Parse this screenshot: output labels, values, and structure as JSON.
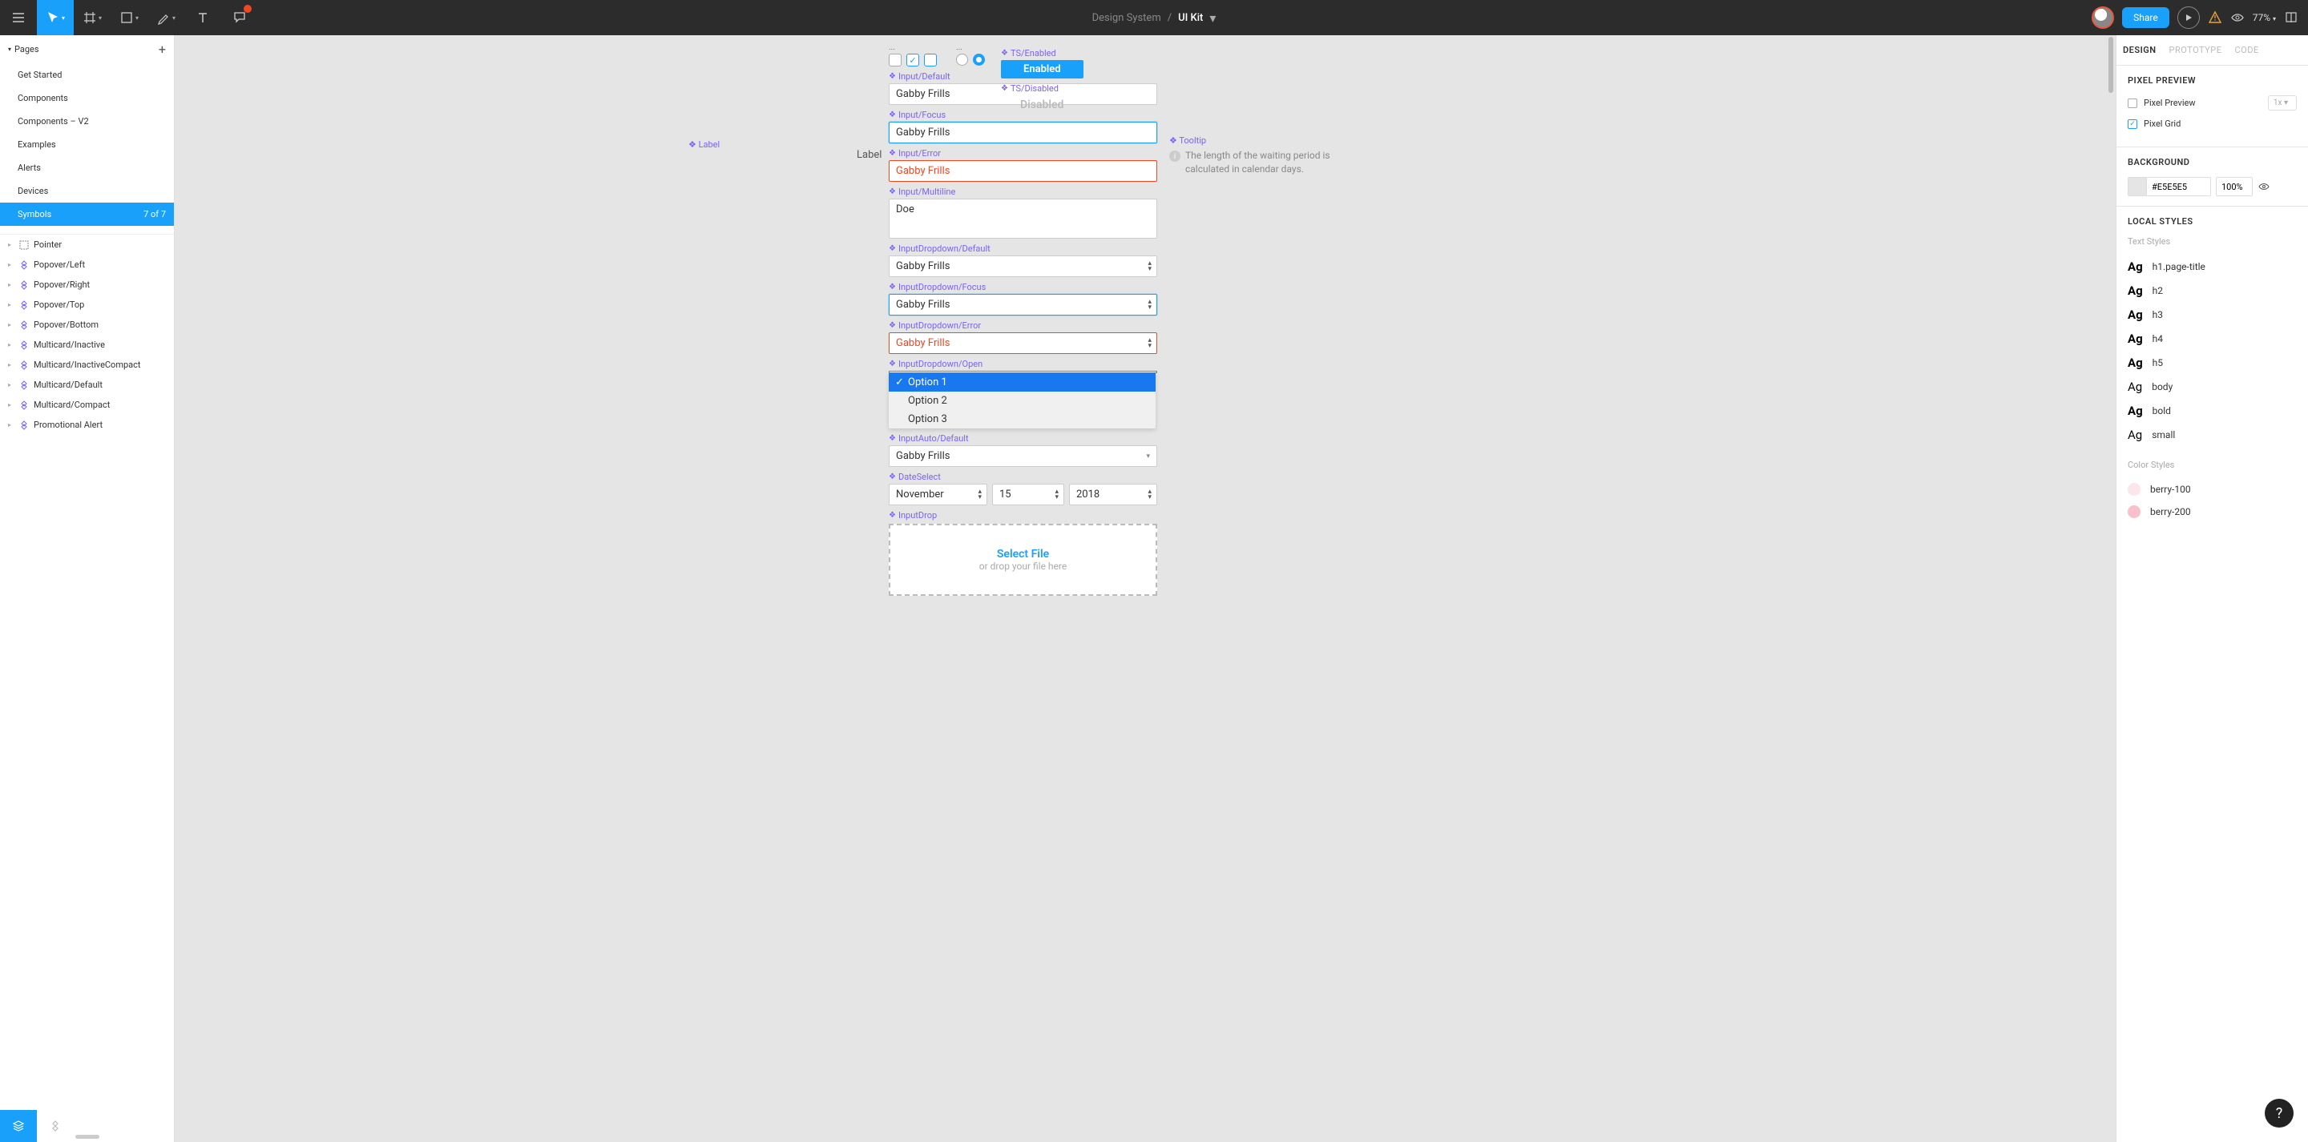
{
  "toolbar": {
    "breadcrumb_parent": "Design System",
    "breadcrumb_sep": "/",
    "breadcrumb_current": "UI Kit",
    "share_label": "Share",
    "zoom": "77%"
  },
  "left": {
    "pages_title": "Pages",
    "pages": [
      {
        "label": "Get Started"
      },
      {
        "label": "Components"
      },
      {
        "label": "Components – V2"
      },
      {
        "label": "Examples"
      },
      {
        "label": "Alerts"
      },
      {
        "label": "Devices"
      }
    ],
    "active_page": {
      "label": "Symbols",
      "count": "7 of 7"
    },
    "layers": [
      {
        "label": "Pointer",
        "icon": "frame"
      },
      {
        "label": "Popover/Left",
        "icon": "comp"
      },
      {
        "label": "Popover/Right",
        "icon": "comp"
      },
      {
        "label": "Popover/Top",
        "icon": "comp"
      },
      {
        "label": "Popover/Bottom",
        "icon": "comp"
      },
      {
        "label": "Multicard/Inactive",
        "icon": "comp"
      },
      {
        "label": "Multicard/InactiveCompact",
        "icon": "comp"
      },
      {
        "label": "Multicard/Default",
        "icon": "comp"
      },
      {
        "label": "Multicard/Compact",
        "icon": "comp"
      },
      {
        "label": "Promotional Alert",
        "icon": "comp"
      }
    ]
  },
  "canvas": {
    "side_label": "Label",
    "label_text": "Label",
    "ts_enabled_label": "TS/Enabled",
    "ts_enabled_text": "Enabled",
    "ts_disabled_label": "TS/Disabled",
    "ts_disabled_text": "Disabled",
    "tooltip_label": "Tooltip",
    "tooltip_text": "The length of the waiting period is calculated in calendar days.",
    "components": {
      "input_default": {
        "label": "Input/Default",
        "value": "Gabby Frills"
      },
      "input_focus": {
        "label": "Input/Focus",
        "value": "Gabby Frills"
      },
      "input_error": {
        "label": "Input/Error",
        "value": "Gabby Frills"
      },
      "input_multiline": {
        "label": "Input/Multiline",
        "value": "Doe"
      },
      "dd_default": {
        "label": "InputDropdown/Default",
        "value": "Gabby Frills"
      },
      "dd_focus": {
        "label": "InputDropdown/Focus",
        "value": "Gabby Frills"
      },
      "dd_error": {
        "label": "InputDropdown/Error",
        "value": "Gabby Frills"
      },
      "dd_open": {
        "label": "InputDropdown/Open",
        "options": [
          "Option 1",
          "Option 2",
          "Option 3"
        ]
      },
      "auto_default": {
        "label": "InputAuto/Default",
        "value": "Gabby Frills"
      },
      "date_select": {
        "label": "DateSelect",
        "month": "November",
        "day": "15",
        "year": "2018"
      },
      "input_drop": {
        "label": "InputDrop",
        "select": "Select File",
        "hint": "or drop your file here"
      }
    }
  },
  "right": {
    "tabs": [
      "DESIGN",
      "PROTOTYPE",
      "CODE"
    ],
    "pixel_preview_title": "PIXEL PREVIEW",
    "pixel_preview_label": "Pixel Preview",
    "pixel_preview_scale": "1x",
    "pixel_grid_label": "Pixel Grid",
    "background_title": "BACKGROUND",
    "background_hex": "#E5E5E5",
    "background_opacity": "100%",
    "local_styles_title": "LOCAL STYLES",
    "text_styles_label": "Text Styles",
    "text_styles": [
      {
        "name": "h1.page-title",
        "weight": "bold"
      },
      {
        "name": "h2",
        "weight": "bold"
      },
      {
        "name": "h3",
        "weight": "bold"
      },
      {
        "name": "h4",
        "weight": "bold"
      },
      {
        "name": "h5",
        "weight": "bold"
      },
      {
        "name": "body",
        "weight": "light"
      },
      {
        "name": "bold",
        "weight": "bold"
      },
      {
        "name": "small",
        "weight": "light"
      }
    ],
    "color_styles_label": "Color Styles",
    "color_styles": [
      {
        "name": "berry-100",
        "hex": "#fde6ea"
      },
      {
        "name": "berry-200",
        "hex": "#f9c0cc"
      }
    ]
  },
  "help": "?"
}
